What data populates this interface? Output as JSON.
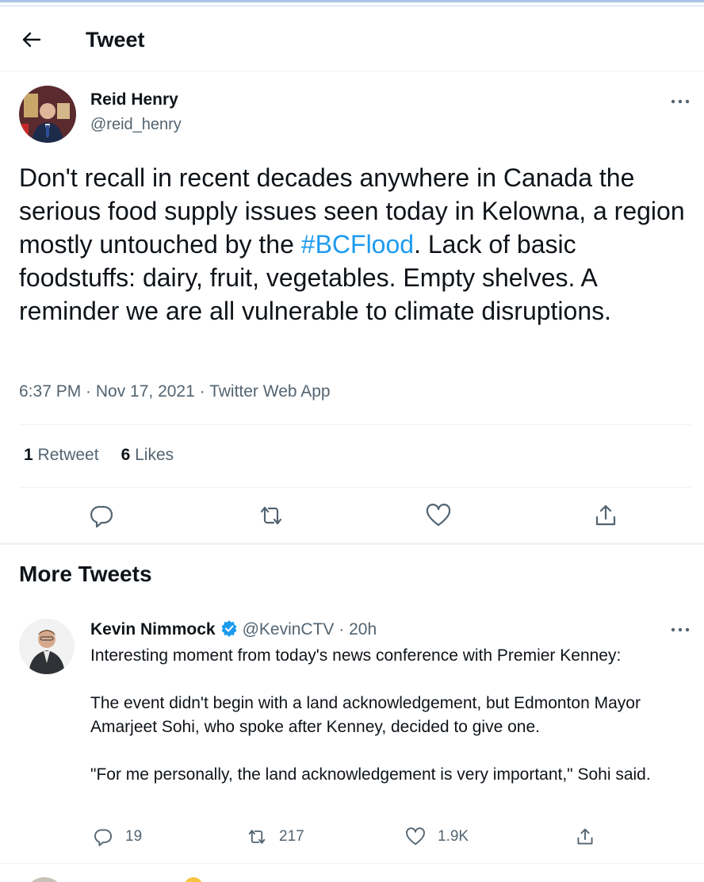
{
  "header": {
    "title": "Tweet",
    "back_icon": "arrow-left-icon"
  },
  "tweet": {
    "author": {
      "name": "Reid Henry",
      "handle": "@reid_henry"
    },
    "text_before": "Don't recall in recent decades anywhere in Canada the serious food supply issues seen today in Kelowna, a region mostly untouched by the ",
    "hashtag": "#BCFlood",
    "text_after": ". Lack of basic foodstuffs: dairy, fruit, vegetables. Empty shelves. A reminder we are all vulnerable to climate disruptions.",
    "meta": "6:37 PM · Nov 17, 2021 · Twitter Web App",
    "retweet_count": "1",
    "retweet_label": "Retweet",
    "like_count": "6",
    "like_label": "Likes"
  },
  "more_tweets": {
    "title": "More Tweets",
    "items": [
      {
        "name": "Kevin Nimmock",
        "handle": "@KevinCTV",
        "time": "· 20h",
        "paragraphs": [
          "Interesting moment from today's news conference with Premier Kenney:",
          "The event didn't begin with a land acknowledgement, but Edmonton Mayor Amarjeet Sohi, who spoke after Kenney, decided to give one.",
          "\"For me personally, the land acknowledgement is very important,\" Sohi said."
        ],
        "replies": "19",
        "retweets": "217",
        "likes": "1.9K"
      }
    ]
  },
  "colors": {
    "accent": "#1d9bf0",
    "text": "#0f1419",
    "muted": "#536471",
    "divider": "#eff3f4"
  }
}
